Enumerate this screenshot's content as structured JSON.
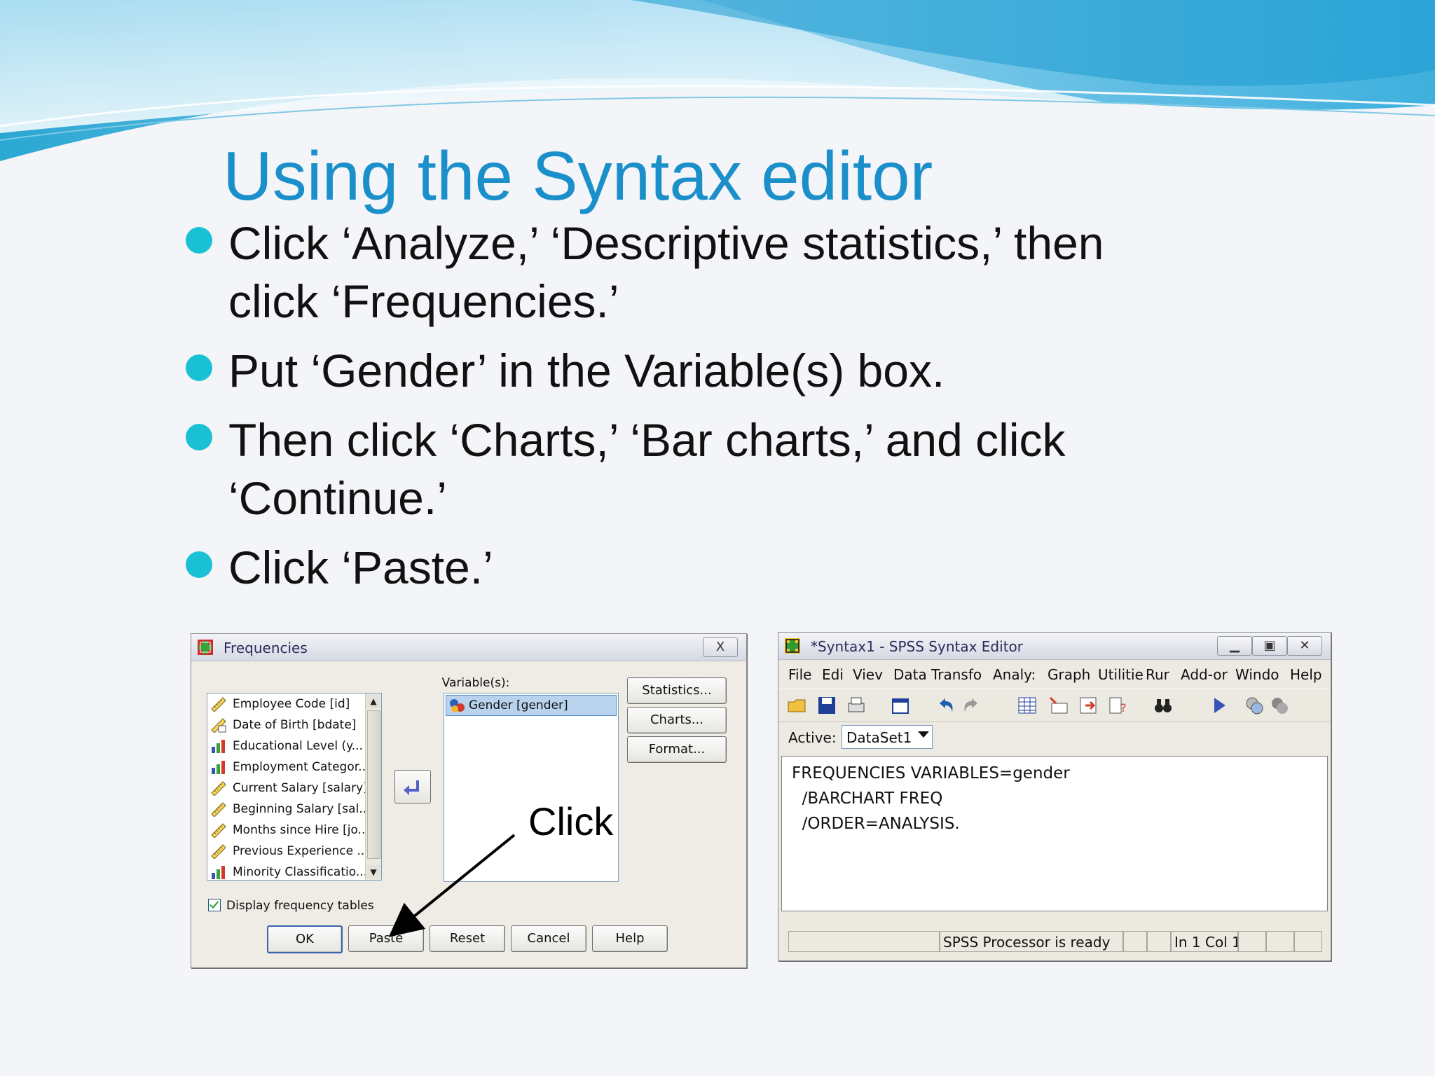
{
  "slide": {
    "title": "Using the Syntax editor",
    "bullets": [
      {
        "line1": "Click ‘Analyze,’ ‘Descriptive statistics,’ then",
        "line2": "click ‘Frequencies.’"
      },
      {
        "line1": "Put ‘Gender’ in the Variable(s) box.",
        "line2": ""
      },
      {
        "line1": "Then click ‘Charts,’ ‘Bar charts,’ and click",
        "line2": "‘Continue.’"
      },
      {
        "line1": "Click ‘Paste.’",
        "line2": ""
      }
    ],
    "callout": "Click"
  },
  "frequencies": {
    "title": "Frequencies",
    "close": "X",
    "variables": [
      {
        "label": "Employee Code [id]",
        "icon": "ruler-icon"
      },
      {
        "label": "Date of Birth [bdate]",
        "icon": "date-ruler-icon"
      },
      {
        "label": "Educational Level (y...",
        "icon": "bar-ordinal-icon"
      },
      {
        "label": "Employment Categor...",
        "icon": "bar-ordinal-icon"
      },
      {
        "label": "Current Salary [salary]",
        "icon": "ruler-icon"
      },
      {
        "label": "Beginning Salary [sal...",
        "icon": "ruler-icon"
      },
      {
        "label": "Months since Hire [jo...",
        "icon": "ruler-icon"
      },
      {
        "label": "Previous Experience ...",
        "icon": "ruler-icon"
      },
      {
        "label": "Minority Classificatio...",
        "icon": "bar-ordinal-icon"
      }
    ],
    "variables_label": "Variable(s):",
    "selected_variable": "Gender [gender]",
    "side_buttons": [
      "Statistics...",
      "Charts...",
      "Format..."
    ],
    "checkbox_label": "Display frequency tables",
    "bottom_buttons": [
      "OK",
      "Paste",
      "Reset",
      "Cancel",
      "Help"
    ]
  },
  "syntax_editor": {
    "title": "*Syntax1 - SPSS Syntax Editor",
    "menus": [
      "File",
      "Edi",
      "Viev",
      "Data",
      "Transfo",
      "Analy:",
      "Graph",
      "Utilitie",
      "Rur",
      "Add-or",
      "Windo",
      "Help"
    ],
    "active_label": "Active:",
    "active_dataset": "DataSet1",
    "code_lines": [
      "FREQUENCIES VARIABLES=gender",
      "  /BARCHART FREQ",
      "  /ORDER=ANALYSIS."
    ],
    "status": "SPSS  Processor is ready",
    "position": "In 1 Col 1"
  },
  "colors": {
    "title": "#1a8fca",
    "bullet": "#1ac0d4"
  }
}
